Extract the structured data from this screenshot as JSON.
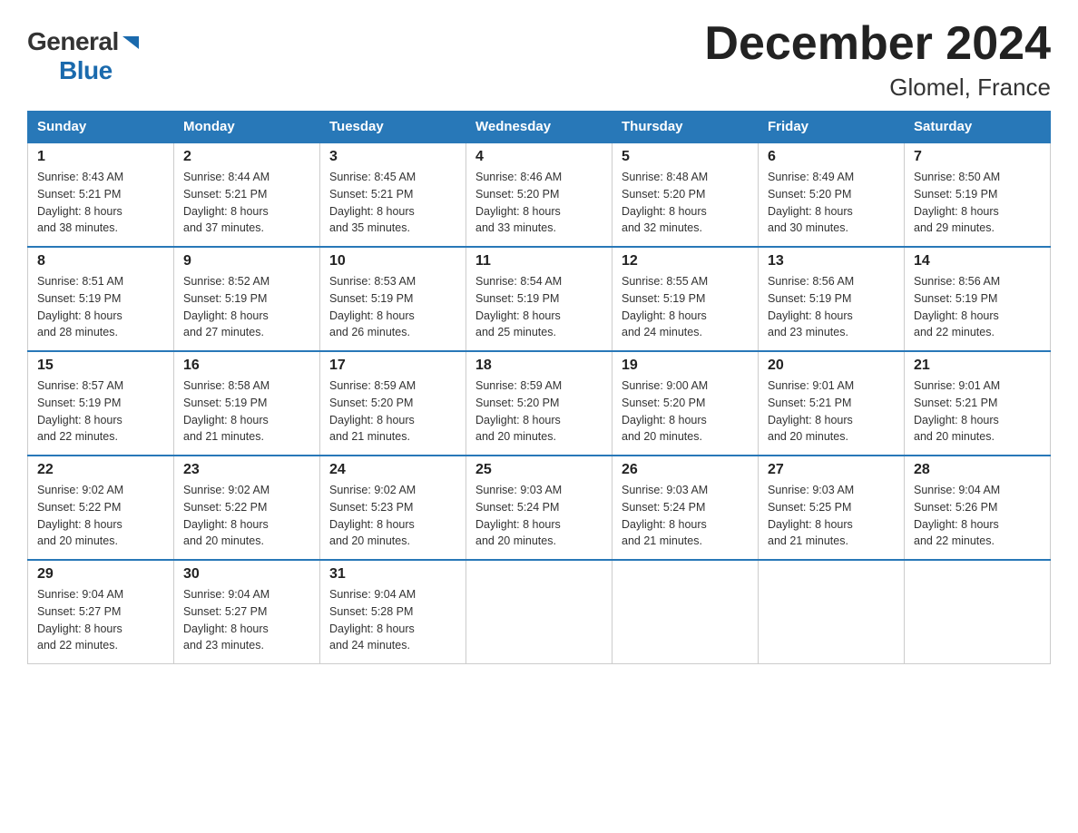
{
  "logo": {
    "general": "General",
    "blue": "Blue",
    "triangle": "▶"
  },
  "title": "December 2024",
  "subtitle": "Glomel, France",
  "days_of_week": [
    "Sunday",
    "Monday",
    "Tuesday",
    "Wednesday",
    "Thursday",
    "Friday",
    "Saturday"
  ],
  "weeks": [
    [
      {
        "day": "1",
        "sunrise": "8:43 AM",
        "sunset": "5:21 PM",
        "daylight": "8 hours and 38 minutes."
      },
      {
        "day": "2",
        "sunrise": "8:44 AM",
        "sunset": "5:21 PM",
        "daylight": "8 hours and 37 minutes."
      },
      {
        "day": "3",
        "sunrise": "8:45 AM",
        "sunset": "5:21 PM",
        "daylight": "8 hours and 35 minutes."
      },
      {
        "day": "4",
        "sunrise": "8:46 AM",
        "sunset": "5:20 PM",
        "daylight": "8 hours and 33 minutes."
      },
      {
        "day": "5",
        "sunrise": "8:48 AM",
        "sunset": "5:20 PM",
        "daylight": "8 hours and 32 minutes."
      },
      {
        "day": "6",
        "sunrise": "8:49 AM",
        "sunset": "5:20 PM",
        "daylight": "8 hours and 30 minutes."
      },
      {
        "day": "7",
        "sunrise": "8:50 AM",
        "sunset": "5:19 PM",
        "daylight": "8 hours and 29 minutes."
      }
    ],
    [
      {
        "day": "8",
        "sunrise": "8:51 AM",
        "sunset": "5:19 PM",
        "daylight": "8 hours and 28 minutes."
      },
      {
        "day": "9",
        "sunrise": "8:52 AM",
        "sunset": "5:19 PM",
        "daylight": "8 hours and 27 minutes."
      },
      {
        "day": "10",
        "sunrise": "8:53 AM",
        "sunset": "5:19 PM",
        "daylight": "8 hours and 26 minutes."
      },
      {
        "day": "11",
        "sunrise": "8:54 AM",
        "sunset": "5:19 PM",
        "daylight": "8 hours and 25 minutes."
      },
      {
        "day": "12",
        "sunrise": "8:55 AM",
        "sunset": "5:19 PM",
        "daylight": "8 hours and 24 minutes."
      },
      {
        "day": "13",
        "sunrise": "8:56 AM",
        "sunset": "5:19 PM",
        "daylight": "8 hours and 23 minutes."
      },
      {
        "day": "14",
        "sunrise": "8:56 AM",
        "sunset": "5:19 PM",
        "daylight": "8 hours and 22 minutes."
      }
    ],
    [
      {
        "day": "15",
        "sunrise": "8:57 AM",
        "sunset": "5:19 PM",
        "daylight": "8 hours and 22 minutes."
      },
      {
        "day": "16",
        "sunrise": "8:58 AM",
        "sunset": "5:19 PM",
        "daylight": "8 hours and 21 minutes."
      },
      {
        "day": "17",
        "sunrise": "8:59 AM",
        "sunset": "5:20 PM",
        "daylight": "8 hours and 21 minutes."
      },
      {
        "day": "18",
        "sunrise": "8:59 AM",
        "sunset": "5:20 PM",
        "daylight": "8 hours and 20 minutes."
      },
      {
        "day": "19",
        "sunrise": "9:00 AM",
        "sunset": "5:20 PM",
        "daylight": "8 hours and 20 minutes."
      },
      {
        "day": "20",
        "sunrise": "9:01 AM",
        "sunset": "5:21 PM",
        "daylight": "8 hours and 20 minutes."
      },
      {
        "day": "21",
        "sunrise": "9:01 AM",
        "sunset": "5:21 PM",
        "daylight": "8 hours and 20 minutes."
      }
    ],
    [
      {
        "day": "22",
        "sunrise": "9:02 AM",
        "sunset": "5:22 PM",
        "daylight": "8 hours and 20 minutes."
      },
      {
        "day": "23",
        "sunrise": "9:02 AM",
        "sunset": "5:22 PM",
        "daylight": "8 hours and 20 minutes."
      },
      {
        "day": "24",
        "sunrise": "9:02 AM",
        "sunset": "5:23 PM",
        "daylight": "8 hours and 20 minutes."
      },
      {
        "day": "25",
        "sunrise": "9:03 AM",
        "sunset": "5:24 PM",
        "daylight": "8 hours and 20 minutes."
      },
      {
        "day": "26",
        "sunrise": "9:03 AM",
        "sunset": "5:24 PM",
        "daylight": "8 hours and 21 minutes."
      },
      {
        "day": "27",
        "sunrise": "9:03 AM",
        "sunset": "5:25 PM",
        "daylight": "8 hours and 21 minutes."
      },
      {
        "day": "28",
        "sunrise": "9:04 AM",
        "sunset": "5:26 PM",
        "daylight": "8 hours and 22 minutes."
      }
    ],
    [
      {
        "day": "29",
        "sunrise": "9:04 AM",
        "sunset": "5:27 PM",
        "daylight": "8 hours and 22 minutes."
      },
      {
        "day": "30",
        "sunrise": "9:04 AM",
        "sunset": "5:27 PM",
        "daylight": "8 hours and 23 minutes."
      },
      {
        "day": "31",
        "sunrise": "9:04 AM",
        "sunset": "5:28 PM",
        "daylight": "8 hours and 24 minutes."
      },
      null,
      null,
      null,
      null
    ]
  ],
  "labels": {
    "sunrise": "Sunrise:",
    "sunset": "Sunset:",
    "daylight": "Daylight:"
  }
}
